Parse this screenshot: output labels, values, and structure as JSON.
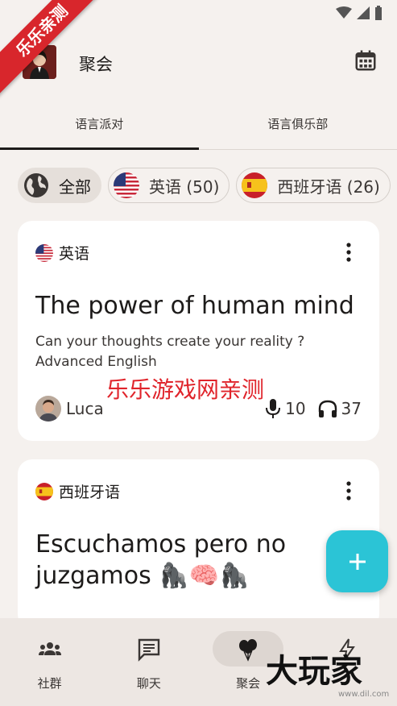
{
  "ribbon": {
    "text": "乐乐亲测"
  },
  "header": {
    "title": "聚会"
  },
  "tabs": [
    {
      "label": "语言派对"
    },
    {
      "label": "语言俱乐部"
    }
  ],
  "filters": [
    {
      "label": "全部",
      "icon": "globe-icon"
    },
    {
      "label": "英语 (50)",
      "icon": "us-flag-icon"
    },
    {
      "label": "西班牙语 (26)",
      "icon": "spain-flag-icon"
    }
  ],
  "cards": [
    {
      "language": "英语",
      "title": "The power of human mind",
      "description_line1": "Can your thoughts  create your reality ?",
      "description_line2": "Advanced English",
      "host": "Luca",
      "speakers": "10",
      "listeners": "37"
    },
    {
      "language": "西班牙语",
      "title_line1": "Escuchamos pero no",
      "title_line2": "juzgamos 🦍🧠🦍"
    }
  ],
  "watermark": "乐乐游戏网亲测",
  "nav": [
    {
      "label": "社群",
      "icon": "community-icon"
    },
    {
      "label": "聊天",
      "icon": "chat-icon"
    },
    {
      "label": "聚会",
      "icon": "balloons-icon"
    },
    {
      "label": "",
      "icon": "bolt-icon"
    }
  ],
  "bottom_watermark": {
    "text": "大玩家",
    "url": "www.dil.com"
  },
  "colors": {
    "accent": "#2bc4d6",
    "background": "#f5f1ee",
    "card": "#ffffff",
    "watermark": "#e0242b"
  }
}
